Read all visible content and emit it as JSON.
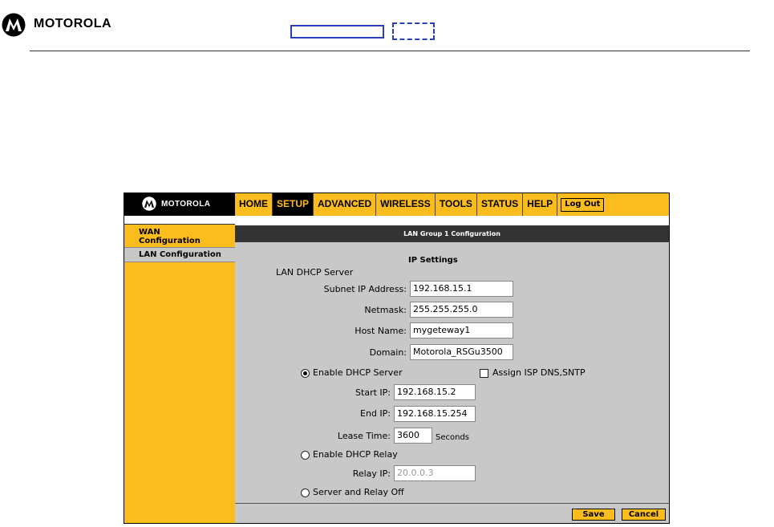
{
  "doc_header": {
    "brand": "MOTOROLA",
    "logo_icon": "motorola-batwing-icon"
  },
  "nav": {
    "brand": "MOTOROLA",
    "items": [
      {
        "label": "HOME",
        "active": false
      },
      {
        "label": "SETUP",
        "active": true
      },
      {
        "label": "ADVANCED",
        "active": false
      },
      {
        "label": "WIRELESS",
        "active": false
      },
      {
        "label": "TOOLS",
        "active": false
      },
      {
        "label": "STATUS",
        "active": false
      },
      {
        "label": "HELP",
        "active": false
      }
    ],
    "logout": "Log Out",
    "accent_color": "#fbbd1d"
  },
  "sidebar": {
    "items": [
      {
        "label": "WAN Configuration",
        "line1": "WAN",
        "line2": "Configuration"
      },
      {
        "label": "LAN Configuration",
        "selected": true
      }
    ]
  },
  "content": {
    "title": "LAN Group 1 Configuration",
    "section": "IP Settings",
    "group_label": "LAN DHCP Server",
    "subnet_label": "Subnet IP Address:",
    "subnet_value": "192.168.15.1",
    "netmask_label": "Netmask:",
    "netmask_value": "255.255.255.0",
    "hostname_label": "Host Name:",
    "hostname_value": "mygeteway1",
    "domain_label": "Domain:",
    "domain_value": "Motorola_RSGu3500",
    "enable_dhcp_server": "Enable DHCP Server",
    "assign_isp": "Assign ISP DNS,SNTP",
    "start_ip_label": "Start IP:",
    "start_ip_value": "192.168.15.2",
    "end_ip_label": "End IP:",
    "end_ip_value": "192.168.15.254",
    "lease_label": "Lease Time:",
    "lease_value": "3600",
    "lease_unit": "Seconds",
    "enable_relay": "Enable DHCP Relay",
    "relay_ip_label": "Relay IP:",
    "relay_ip_value": "20.0.0.3",
    "server_relay_off": "Server and Relay Off",
    "selected_mode": "Enable DHCP Server"
  },
  "footer": {
    "save": "Save",
    "cancel": "Cancel"
  }
}
